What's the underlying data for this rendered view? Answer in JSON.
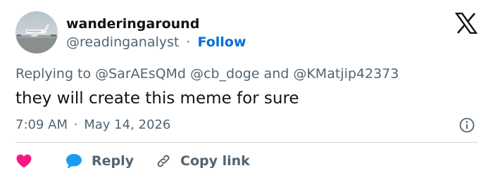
{
  "author": {
    "display_name": "wanderingaround",
    "handle": "@readinganalyst",
    "separator": "·",
    "follow_label": "Follow"
  },
  "reply_context": {
    "prefix": "Replying to",
    "mention_1": "@SarAEsQMd",
    "mention_2": "@cb_doge",
    "conjunction": "and",
    "mention_3": "@KMatjip42373"
  },
  "tweet": {
    "text": "they will create this meme for sure"
  },
  "meta": {
    "time": "7:09 AM",
    "separator": "·",
    "date": "May 14, 2026"
  },
  "actions": {
    "like_icon": "heart-icon",
    "reply_icon": "speech-bubble-icon",
    "reply_label": "Reply",
    "copy_icon": "link-icon",
    "copy_label": "Copy link"
  },
  "icons": {
    "platform_logo": "x-logo-icon",
    "info": "info-icon"
  },
  "colors": {
    "like": "#f91880",
    "reply_bubble": "#1d9bf0",
    "follow": "#006fd6",
    "secondary_text": "#536471",
    "primary_text": "#0f1419",
    "divider": "#cfd9de"
  }
}
